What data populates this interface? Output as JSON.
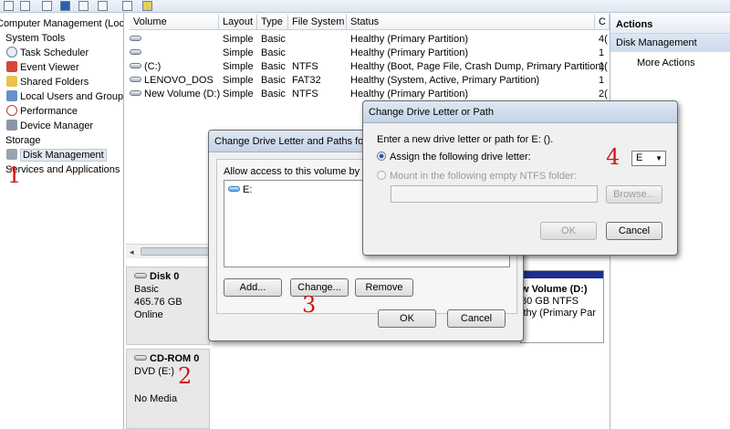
{
  "tree": {
    "items": [
      {
        "label": "Computer Management (Local",
        "icon": "computer-management-icon"
      },
      {
        "label": "System Tools",
        "icon": "tools-icon"
      },
      {
        "label": "Task Scheduler",
        "icon": "clock-icon"
      },
      {
        "label": "Event Viewer",
        "icon": "event-viewer-icon"
      },
      {
        "label": "Shared Folders",
        "icon": "shared-folder-icon"
      },
      {
        "label": "Local Users and Groups",
        "icon": "users-icon"
      },
      {
        "label": "Performance",
        "icon": "performance-icon"
      },
      {
        "label": "Device Manager",
        "icon": "device-manager-icon"
      },
      {
        "label": "Storage",
        "icon": "storage-icon"
      },
      {
        "label": "Disk Management",
        "icon": "disk-icon"
      },
      {
        "label": "Services and Applications",
        "icon": "services-icon"
      }
    ]
  },
  "list": {
    "columns": [
      "Volume",
      "Layout",
      "Type",
      "File System",
      "Status",
      "C"
    ],
    "rows": [
      {
        "volume": "",
        "layout": "Simple",
        "type": "Basic",
        "fs": "",
        "status": "Healthy (Primary Partition)",
        "c": "4("
      },
      {
        "volume": "",
        "layout": "Simple",
        "type": "Basic",
        "fs": "",
        "status": "Healthy (Primary Partition)",
        "c": "1"
      },
      {
        "volume": "(C:)",
        "layout": "Simple",
        "type": "Basic",
        "fs": "NTFS",
        "status": "Healthy (Boot, Page File, Crash Dump, Primary Partition)",
        "c": "1("
      },
      {
        "volume": "LENOVO_DOS",
        "layout": "Simple",
        "type": "Basic",
        "fs": "FAT32",
        "status": "Healthy (System, Active, Primary Partition)",
        "c": "1"
      },
      {
        "volume": "New Volume (D:)",
        "layout": "Simple",
        "type": "Basic",
        "fs": "NTFS",
        "status": "Healthy (Primary Partition)",
        "c": "2("
      }
    ]
  },
  "disks": {
    "disk0": {
      "name": "Disk 0",
      "type": "Basic",
      "size": "465.76 GB",
      "state": "Online"
    },
    "cdrom0": {
      "name": "CD-ROM 0",
      "type": "DVD (E:)",
      "state": "No Media"
    },
    "partition": {
      "name": "w Volume  (D:)",
      "size": "80 GB NTFS",
      "status": "lthy (Primary Par"
    }
  },
  "actions": {
    "header": "Actions",
    "section": "Disk Management",
    "more": "More Actions"
  },
  "dialog1": {
    "title": "Change Drive Letter and Paths for",
    "allow_text": "Allow access to this volume by using",
    "entry": "E:",
    "add": "Add...",
    "change": "Change...",
    "remove": "Remove",
    "ok": "OK",
    "cancel": "Cancel"
  },
  "dialog2": {
    "title": "Change Drive Letter or Path",
    "prompt": "Enter a new drive letter or path for E: ().",
    "assign_label": "Assign the following drive letter:",
    "mount_label": "Mount in the following empty NTFS folder:",
    "selected_letter": "E",
    "browse": "Browse...",
    "ok": "OK",
    "cancel": "Cancel"
  },
  "annotations": {
    "a1": "1",
    "a2": "2",
    "a3": "3",
    "a4": "4"
  },
  "colors": {
    "annotation": "#d01616",
    "partition_bar": "#1d2f8f"
  }
}
